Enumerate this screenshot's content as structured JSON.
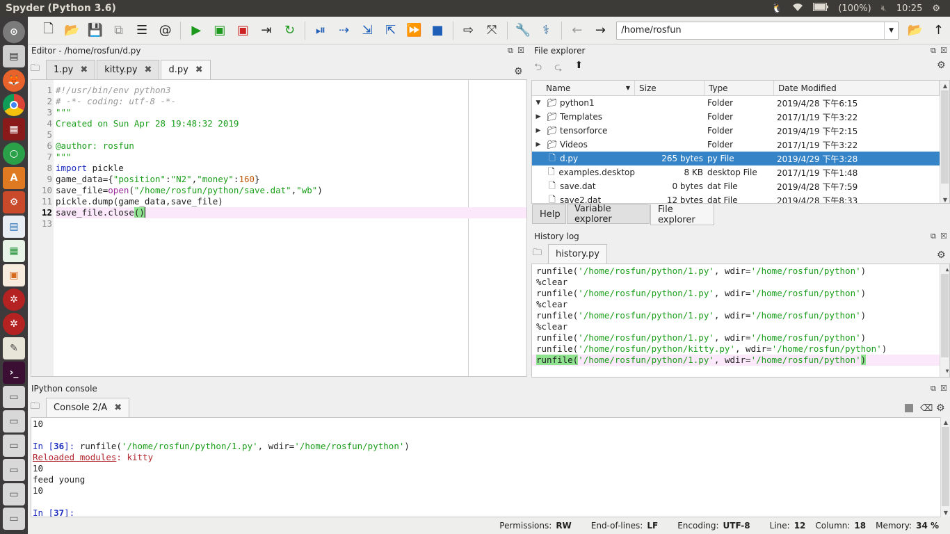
{
  "topbar": {
    "title": "Spyder (Python 3.6)",
    "battery": "(100%)",
    "time": "10:25"
  },
  "launcher": {
    "icons": [
      "dash-icon",
      "files-icon",
      "firefox-icon",
      "chrome-icon",
      "terminal-red-icon",
      "circle-app-icon",
      "software-center-icon",
      "settings-icon",
      "writer-icon",
      "calc-icon",
      "impress-icon",
      "robot-icon",
      "robot2-icon",
      "text-editor-icon",
      "terminal-icon",
      "drive-icon",
      "drive-icon",
      "drive-icon",
      "drive-icon",
      "drive-icon",
      "drive-icon"
    ]
  },
  "toolbar": {
    "path": "/home/rosfun"
  },
  "editor": {
    "title": "Editor - /home/rosfun/d.py",
    "tabs": [
      {
        "label": "1.py"
      },
      {
        "label": "kitty.py"
      },
      {
        "label": "d.py"
      }
    ],
    "line_numbers": [
      "1",
      "2",
      "3",
      "4",
      "5",
      "6",
      "7",
      "8",
      "9",
      "10",
      "11",
      "12",
      "13"
    ],
    "lines": {
      "l1": "#!/usr/bin/env python3",
      "l2": "# -*- coding: utf-8 -*-",
      "l3": "\"\"\"",
      "l4": "Created on Sun Apr 28 19:48:32 2019",
      "l6": "@author: rosfun",
      "l7": "\"\"\"",
      "l8_kw": "import",
      "l8_rest": " pickle",
      "l9_a": "game_data={",
      "l9_s1": "\"position\"",
      "l9_b": ":",
      "l9_s2": "\"N2\"",
      "l9_c": ",",
      "l9_s3": "\"money\"",
      "l9_d": ":",
      "l9_n": "160",
      "l9_e": "}",
      "l10_a": "save_file=",
      "l10_bi": "open",
      "l10_b": "(",
      "l10_s1": "\"/home/rosfun/python/save.dat\"",
      "l10_c": ",",
      "l10_s2": "\"wb\"",
      "l10_d": ")",
      "l11": "pickle.dump(game_data,save_file)",
      "l12_a": "save_file.close",
      "l12_b": "()"
    }
  },
  "file_explorer": {
    "title": "File explorer",
    "columns": [
      "Name",
      "Size",
      "Type",
      "Date Modified"
    ],
    "rows": [
      {
        "name": "python1",
        "size": "",
        "type": "Folder",
        "date": "2019/4/28 下午6:15"
      },
      {
        "name": "Templates",
        "size": "",
        "type": "Folder",
        "date": "2017/1/19 下午3:22"
      },
      {
        "name": "tensorforce",
        "size": "",
        "type": "Folder",
        "date": "2019/4/19 下午2:15"
      },
      {
        "name": "Videos",
        "size": "",
        "type": "Folder",
        "date": "2017/1/19 下午3:22"
      },
      {
        "name": "d.py",
        "size": "265 bytes",
        "type": "py File",
        "date": "2019/4/29 下午3:28"
      },
      {
        "name": "examples.desktop",
        "size": "8 KB",
        "type": "desktop File",
        "date": "2017/1/19 下午1:48"
      },
      {
        "name": "save.dat",
        "size": "0 bytes",
        "type": "dat File",
        "date": "2019/4/28 下午7:59"
      },
      {
        "name": "save2.dat",
        "size": "12 bytes",
        "type": "dat File",
        "date": "2019/4/28 下午8:33"
      }
    ],
    "pane_tabs": [
      "Help",
      "Variable explorer",
      "File explorer"
    ]
  },
  "history": {
    "title": "History log",
    "tab": "history.py",
    "lines": [
      {
        "kind": "run",
        "path": "'/home/rosfun/python/1.py'",
        "wdir": "'/home/rosfun/python'"
      },
      {
        "kind": "plain",
        "text": "%clear"
      },
      {
        "kind": "run",
        "path": "'/home/rosfun/python/1.py'",
        "wdir": "'/home/rosfun/python'"
      },
      {
        "kind": "plain",
        "text": "%clear"
      },
      {
        "kind": "run",
        "path": "'/home/rosfun/python/1.py'",
        "wdir": "'/home/rosfun/python'"
      },
      {
        "kind": "plain",
        "text": "%clear"
      },
      {
        "kind": "run",
        "path": "'/home/rosfun/python/1.py'",
        "wdir": "'/home/rosfun/python'"
      },
      {
        "kind": "run",
        "path": "'/home/rosfun/python/kitty.py'",
        "wdir": "'/home/rosfun/python'"
      },
      {
        "kind": "run",
        "path": "'/home/rosfun/python/1.py'",
        "wdir": "'/home/rosfun/python'"
      }
    ],
    "run_prefix": "runfile(",
    "wdir_label": ", wdir=",
    "close": ")"
  },
  "console": {
    "title": "IPython console",
    "tab": "Console 2/A",
    "out1": "10",
    "in36_prompt": "In [",
    "in36_num": "36",
    "in36_close": "]: ",
    "in36_cmd_a": "runfile(",
    "in36_path": "'/home/rosfun/python/1.py'",
    "in36_cmd_b": ", wdir=",
    "in36_wdir": "'/home/rosfun/python'",
    "in36_cmd_c": ")",
    "reloaded_label": "Reloaded modules",
    "reloaded_sep": ": ",
    "reloaded_mod": "kitty",
    "out2": "10",
    "out3": "feed young",
    "out4": "10",
    "in37_num": "37"
  },
  "status": {
    "permissions_label": "Permissions:",
    "permissions": "RW",
    "eol_label": "End-of-lines:",
    "eol": "LF",
    "encoding_label": "Encoding:",
    "encoding": "UTF-8",
    "line_label": "Line:",
    "line": "12",
    "column_label": "Column:",
    "column": "18",
    "memory_label": "Memory:",
    "memory": "34 %"
  }
}
